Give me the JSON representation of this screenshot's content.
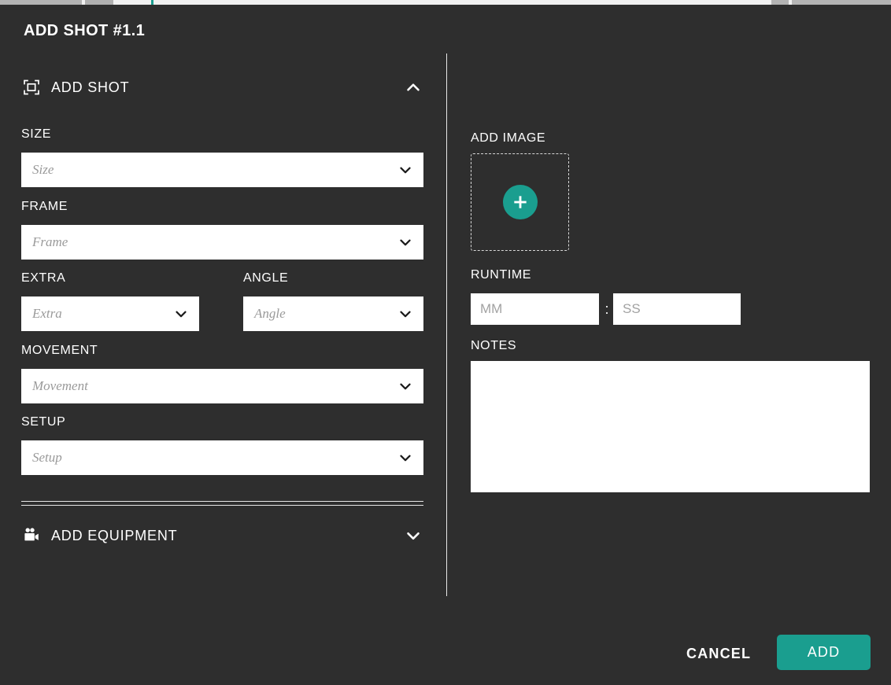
{
  "dialog": {
    "title": "ADD SHOT #1.1"
  },
  "accent_colors": {
    "teal": "#1a9e8f",
    "background": "#2e2e2e",
    "field_background": "#ffffff",
    "text": "#ffffff",
    "placeholder": "#9a9a9a"
  },
  "left_pane": {
    "add_shot_section": {
      "label": "ADD SHOT",
      "icon": "crop-frame-icon",
      "chevron": "chevron-up-icon",
      "expanded": true
    },
    "fields": [
      {
        "key": "size",
        "label": "SIZE",
        "value": "",
        "placeholder": "Size",
        "chevron": "chevron-down-icon"
      },
      {
        "key": "frame",
        "label": "FRAME",
        "value": "",
        "placeholder": "Frame",
        "chevron": "chevron-down-icon"
      },
      {
        "key": "extra",
        "label": "EXTRA",
        "value": "",
        "placeholder": "Extra",
        "chevron": "chevron-down-icon"
      },
      {
        "key": "angle",
        "label": "ANGLE",
        "value": "",
        "placeholder": "Angle",
        "chevron": "chevron-down-icon"
      },
      {
        "key": "movement",
        "label": "MOVEMENT",
        "value": "",
        "placeholder": "Movement",
        "chevron": "chevron-down-icon"
      },
      {
        "key": "setup",
        "label": "SETUP",
        "value": "",
        "placeholder": "Setup",
        "chevron": "chevron-down-icon"
      }
    ],
    "add_equipment_section": {
      "label": "ADD EQUIPMENT",
      "icon": "movie-camera-icon",
      "chevron": "chevron-down-icon",
      "expanded": false
    }
  },
  "right_pane": {
    "add_image": {
      "label": "ADD IMAGE",
      "button_icon": "plus-icon"
    },
    "runtime": {
      "label": "RUNTIME",
      "minutes_value": "",
      "minutes_placeholder": "MM",
      "separator": ":",
      "seconds_value": "",
      "seconds_placeholder": "SS"
    },
    "notes": {
      "label": "NOTES",
      "value": "",
      "placeholder": ""
    }
  },
  "footer": {
    "cancel_label": "CANCEL",
    "add_label": "ADD"
  }
}
